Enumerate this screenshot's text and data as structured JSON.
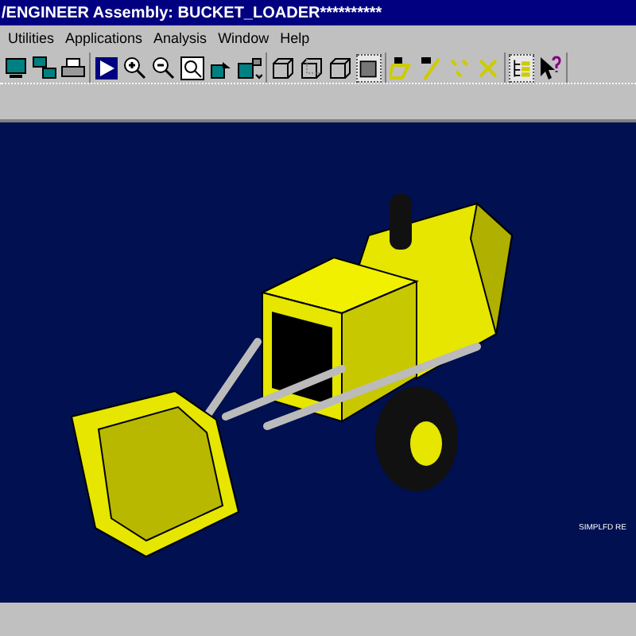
{
  "window": {
    "title": "/ENGINEER Assembly: BUCKET_LOADER**********"
  },
  "menu": [
    "Utilities",
    "Applications",
    "Analysis",
    "Window",
    "Help"
  ],
  "toolbar": [
    [
      {
        "kind": "monitor",
        "pressed": false
      },
      {
        "kind": "network",
        "pressed": false
      },
      {
        "kind": "printer",
        "pressed": false
      }
    ],
    [
      {
        "kind": "play",
        "pressed": false
      },
      {
        "kind": "zoomin",
        "pressed": false
      },
      {
        "kind": "zoomout",
        "pressed": false
      },
      {
        "kind": "zoomfit",
        "pressed": false
      },
      {
        "kind": "orient",
        "pressed": false
      },
      {
        "kind": "view",
        "pressed": false
      }
    ],
    [
      {
        "kind": "wire",
        "pressed": false
      },
      {
        "kind": "hidden",
        "pressed": false
      },
      {
        "kind": "nohidden",
        "pressed": false
      },
      {
        "kind": "shaded",
        "pressed": true
      }
    ],
    [
      {
        "kind": "datum",
        "pressed": false
      },
      {
        "kind": "axis",
        "pressed": false
      },
      {
        "kind": "point",
        "pressed": false
      },
      {
        "kind": "csys",
        "pressed": false
      }
    ],
    [
      {
        "kind": "tree",
        "pressed": true
      },
      {
        "kind": "help",
        "pressed": false
      }
    ]
  ],
  "viewport": {
    "label": "SIMPLFD RE"
  }
}
